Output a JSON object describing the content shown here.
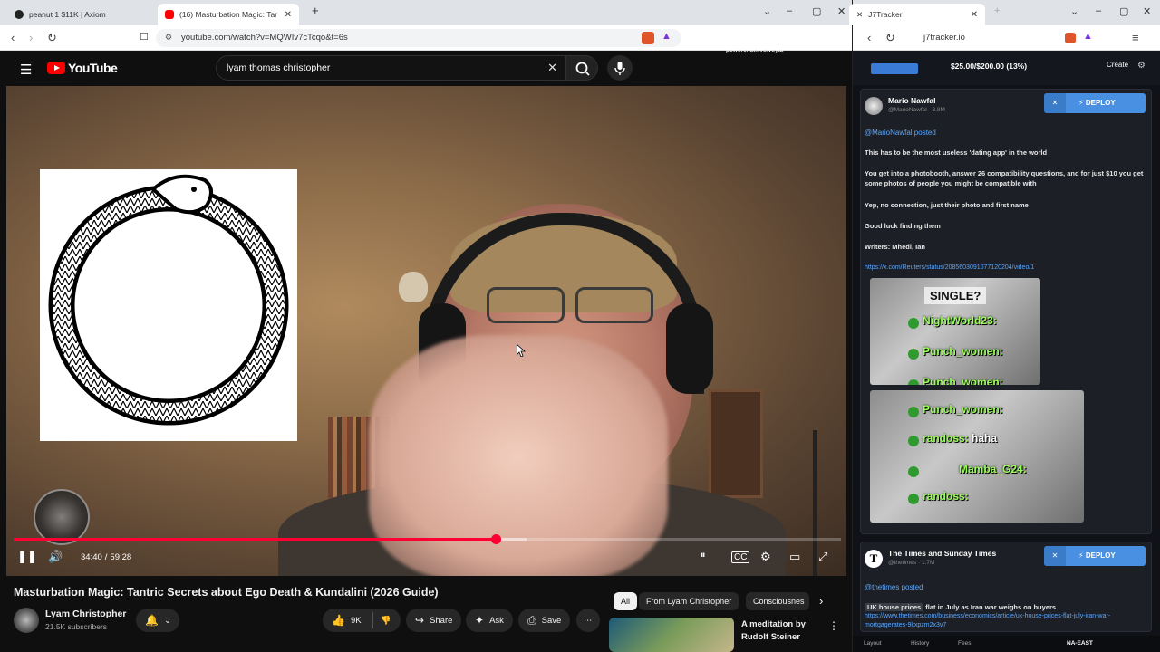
{
  "left_browser": {
    "tabs": [
      {
        "title": "peanut 1 $11K | Axiom",
        "active": false
      },
      {
        "title": "(16) Masturbation Magic: Tar",
        "active": true
      }
    ],
    "url": "youtube.com/watch?v=MQWIv7cTcqo&t=6s"
  },
  "youtube": {
    "logo_text": "YouTube",
    "search_value": "lyam thomas christopher",
    "player": {
      "time_current": "34:40",
      "time_separator": "/",
      "time_total": "59:28",
      "progress_fraction": 0.583,
      "buffered_fraction": 0.62
    },
    "video_title": "Masturbation Magic: Tantric Secrets about Ego Death & Kundalini (2026 Guide)",
    "channel": {
      "name": "Lyam Christopher",
      "subscribers": "21.5K subscribers"
    },
    "actions": {
      "likes": "9K",
      "share": "Share",
      "ask": "Ask",
      "save": "Save"
    },
    "chips": [
      "All",
      "From Lyam Christopher",
      "Consciousnes"
    ],
    "recommendation": {
      "title": "A meditation by Rudolf Steiner"
    }
  },
  "right_browser": {
    "tab_title": "J7Tracker",
    "url": "j7tracker.io",
    "small_text": "powerchat.live/veyta",
    "budget": "$25.00/$200.00 (13%)",
    "create_label": "Create",
    "posts": [
      {
        "author": "Mario Nawfal",
        "handle": "@MarioNawfal",
        "followers": "3.8M",
        "deploy": "DEPLOY",
        "posted_label": "@MarioNawfal posted",
        "lines": [
          "This has to be the most useless 'dating app' in the world",
          "You get into a photobooth, answer 26 compatibility questions, and for just $10 you get some photos of people you might be compatible with",
          "Yep, no connection, just their photo and first name",
          "Good luck finding them",
          "Writers: Mhedi, Ian"
        ],
        "link": "https://x.com/Reuters/status/2085603091077120204/video/1",
        "meme_top": {
          "caption": "SINGLE?",
          "rows": [
            {
              "name": "NightWorld23:",
              "msg": ""
            },
            {
              "name": "Punch_women:",
              "msg": ""
            },
            {
              "name": "Punch_women:",
              "msg": ""
            }
          ]
        },
        "meme_bottom": {
          "rows": [
            {
              "name": "Punch_women:",
              "msg": ""
            },
            {
              "name": "randoss:",
              "msg": "haha"
            },
            {
              "name": "Mamba_G24:",
              "msg": ""
            },
            {
              "name": "randoss:",
              "msg": ""
            }
          ]
        }
      },
      {
        "author": "The Times and Sunday Times",
        "handle": "@thetimes",
        "followers": "1.7M",
        "deploy": "DEPLOY",
        "posted_label": "@thetimes posted",
        "headline_tag": "UK house prices",
        "headline_rest": "flat in July as Iran war weighs on buyers",
        "link": "https://www.thetimes.com/business/economics/article/uk-house-prices-flat-july-iran-war-mortgagerates-9kxpzm2x3v7"
      }
    ],
    "statusbar": {
      "layout": "Layout",
      "history": "History",
      "fees": "Fees",
      "region": "NA-EAST"
    }
  }
}
